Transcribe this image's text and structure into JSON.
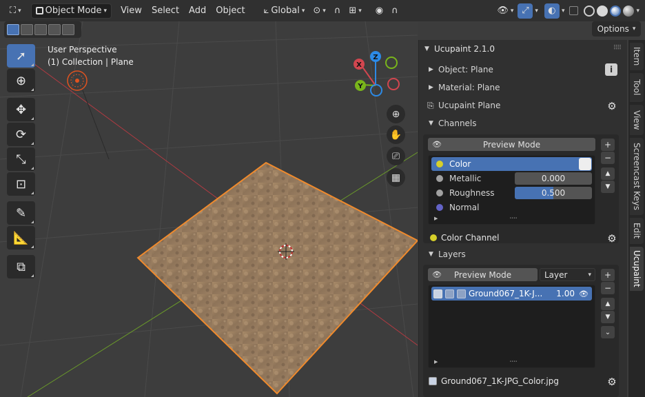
{
  "topbar": {
    "mode": "Object Mode",
    "menus": [
      "View",
      "Select",
      "Add",
      "Object"
    ],
    "orientation": "Global"
  },
  "viewport": {
    "perspective_label": "User Perspective",
    "collection_label": "(1) Collection | Plane",
    "options_label": "Options",
    "gizmo": {
      "x": "X",
      "y": "Y",
      "z": "Z"
    },
    "colors": {
      "x_axis": "#d2464f",
      "y_axis": "#79b51b",
      "z_axis": "#2c8ae6",
      "selection": "#f08a2c",
      "background": "#3d3d3d"
    }
  },
  "panel": {
    "title": "Ucupaint 2.1.0",
    "object_label": "Object: Plane",
    "material_label": "Material: Plane",
    "ucupaint_label": "Ucupaint Plane",
    "channels_label": "Channels",
    "preview_mode_label": "Preview Mode",
    "channels": [
      {
        "name": "Color",
        "color": "#d6cf2a",
        "selected": true
      },
      {
        "name": "Metallic",
        "color": "#a1a1a1",
        "value": "0.000"
      },
      {
        "name": "Roughness",
        "color": "#a1a1a1",
        "value": "0.500",
        "fill": 0.5
      },
      {
        "name": "Normal",
        "color": "#6363c7"
      }
    ],
    "color_channel_label": "Color Channel",
    "layers_label": "Layers",
    "layers_preview_label": "Preview Mode",
    "layer_dropdown": "Layer",
    "layers": [
      {
        "name": "Ground067_1K-J...",
        "value": "1.00"
      }
    ],
    "image_label": "Ground067_1K-JPG_Color.jpg",
    "accent": "#4772b3"
  },
  "tabs": [
    "Item",
    "Tool",
    "View",
    "Screencast Keys",
    "Edit",
    "Ucupaint"
  ],
  "active_tab": "Ucupaint"
}
